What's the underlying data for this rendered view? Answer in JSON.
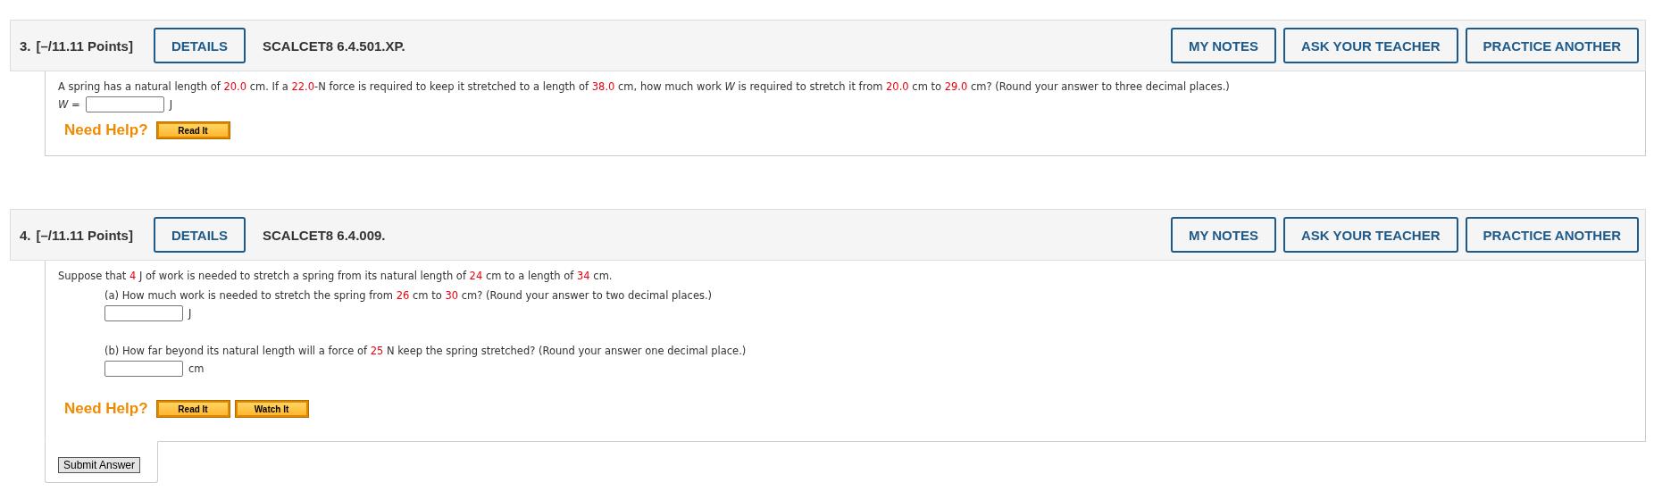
{
  "questions": [
    {
      "number": "3.",
      "points": "[–/11.11 Points]",
      "details": "DETAILS",
      "code": "SCALCET8 6.4.501.XP.",
      "actions": [
        "MY NOTES",
        "ASK YOUR TEACHER",
        "PRACTICE ANOTHER"
      ],
      "prompt": [
        {
          "kind": "plain",
          "text": "A spring has a natural length of "
        },
        {
          "kind": "value",
          "text": "20.0"
        },
        {
          "kind": "plain",
          "text": " cm. If a "
        },
        {
          "kind": "value",
          "text": "22.0"
        },
        {
          "kind": "plain",
          "text": "-N force is required to keep it stretched to a length of "
        },
        {
          "kind": "value",
          "text": "38.0"
        },
        {
          "kind": "plain",
          "text": " cm, how much work *W* is required to stretch it from "
        },
        {
          "kind": "value",
          "text": "20.0"
        },
        {
          "kind": "plain",
          "text": " cm to "
        },
        {
          "kind": "value",
          "text": "29.0"
        },
        {
          "kind": "plain",
          "text": " cm? (Round your answer to three decimal places.)"
        }
      ],
      "answer": {
        "prefix": "*W* =",
        "unit": "J"
      },
      "need_help": "Need Help?",
      "help_buttons": [
        "Read It"
      ]
    },
    {
      "number": "4.",
      "points": "[–/11.11 Points]",
      "details": "DETAILS",
      "code": "SCALCET8 6.4.009.",
      "actions": [
        "MY NOTES",
        "ASK YOUR TEACHER",
        "PRACTICE ANOTHER"
      ],
      "prompt": [
        {
          "kind": "plain",
          "text": "Suppose that "
        },
        {
          "kind": "value",
          "text": "4"
        },
        {
          "kind": "plain",
          "text": " J of work is needed to stretch a spring from its natural length of "
        },
        {
          "kind": "value",
          "text": "24"
        },
        {
          "kind": "plain",
          "text": " cm to a length of "
        },
        {
          "kind": "value",
          "text": "34"
        },
        {
          "kind": "plain",
          "text": " cm."
        }
      ],
      "parts": [
        {
          "segments": [
            {
              "kind": "plain",
              "text": "(a) How much work is needed to stretch the spring from "
            },
            {
              "kind": "value",
              "text": "26"
            },
            {
              "kind": "plain",
              "text": " cm to "
            },
            {
              "kind": "value",
              "text": "30"
            },
            {
              "kind": "plain",
              "text": " cm? (Round your answer to two decimal places.)"
            }
          ],
          "unit": "J"
        },
        {
          "segments": [
            {
              "kind": "plain",
              "text": "(b) How far beyond its natural length will a force of "
            },
            {
              "kind": "value",
              "text": "25"
            },
            {
              "kind": "plain",
              "text": " N keep the spring stretched? (Round your answer one decimal place.)"
            }
          ],
          "unit": "cm"
        }
      ],
      "need_help": "Need Help?",
      "help_buttons": [
        "Read It",
        "Watch It"
      ],
      "submit": "Submit Answer"
    }
  ]
}
